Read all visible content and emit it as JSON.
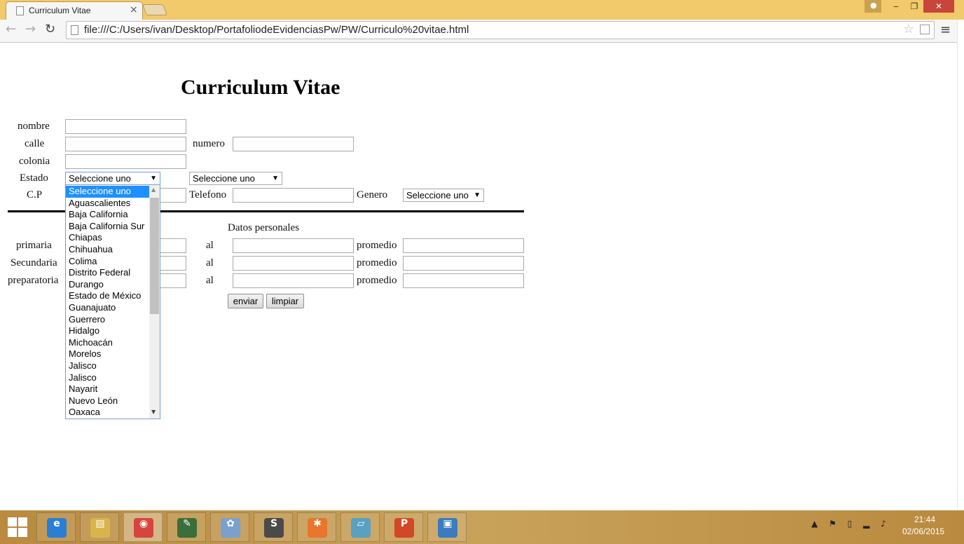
{
  "browser": {
    "tab_title": "Curriculum Vitae",
    "tab_close": "×",
    "url": "file:///C:/Users/ivan/Desktop/PortafoliodeEvidenciasPw/PW/Curriculo%20vitae.html",
    "user_icon": "person-icon",
    "min_glyph": "‒",
    "max_glyph": "❐",
    "close_glyph": "✕",
    "back_glyph": "←",
    "fwd_glyph": "→",
    "reload_glyph": "↻",
    "star_glyph": "☆",
    "menu_glyph": "≡"
  },
  "form": {
    "title": "Curriculum Vitae",
    "labels": {
      "nombre": "nombre",
      "calle": "calle",
      "numero": "numero",
      "colonia": "colonia",
      "estado": "Estado",
      "cp": "C.P",
      "telefono": "Telefono",
      "genero": "Genero",
      "datos_personales": "Datos personales",
      "primaria": "primaria",
      "secundaria": "Secundaria",
      "preparatoria": "preparatoria",
      "al": "al",
      "promedio": "promedio"
    },
    "estado_select": "Seleccione uno",
    "municipio_select": "Seleccione uno",
    "genero_select": "Seleccione uno",
    "enviar": "enviar",
    "limpiar": "limpiar"
  },
  "dropdown": {
    "options": [
      "Seleccione uno",
      "Aguascalientes",
      "Baja California",
      "Baja California Sur",
      "Chiapas",
      "Chihuahua",
      "Colima",
      "Distrito Federal",
      "Durango",
      "Estado de México",
      "Guanajuato",
      "Guerrero",
      "Hidalgo",
      "Michoacán",
      "Morelos",
      "Jalisco",
      "Jalisco",
      "Nayarit",
      "Nuevo León",
      "Oaxaca"
    ],
    "selected_index": 0
  },
  "taskbar": {
    "time": "21:44",
    "date": "02/06/2015",
    "tray_icons": "▲ ⚑ ▯ ▂ ♪",
    "items": [
      {
        "name": "internet-explorer-icon",
        "glyph": "e",
        "color": "#2a7fd4"
      },
      {
        "name": "file-explorer-icon",
        "glyph": "▤",
        "color": "#d9b44a"
      },
      {
        "name": "chrome-icon",
        "glyph": "◉",
        "color": "#d6453b"
      },
      {
        "name": "network-tool-icon",
        "glyph": "✎",
        "color": "#3a6e3a"
      },
      {
        "name": "paint-icon",
        "glyph": "✿",
        "color": "#7aa0d0"
      },
      {
        "name": "sublime-text-icon",
        "glyph": "S",
        "color": "#4a4a4a"
      },
      {
        "name": "xampp-icon",
        "glyph": "✱",
        "color": "#e8762d"
      },
      {
        "name": "notepad-icon",
        "glyph": "▱",
        "color": "#5aa0c0"
      },
      {
        "name": "powerpoint-icon",
        "glyph": "P",
        "color": "#d24726"
      },
      {
        "name": "photo-viewer-icon",
        "glyph": "▣",
        "color": "#3b7bbf"
      }
    ]
  }
}
